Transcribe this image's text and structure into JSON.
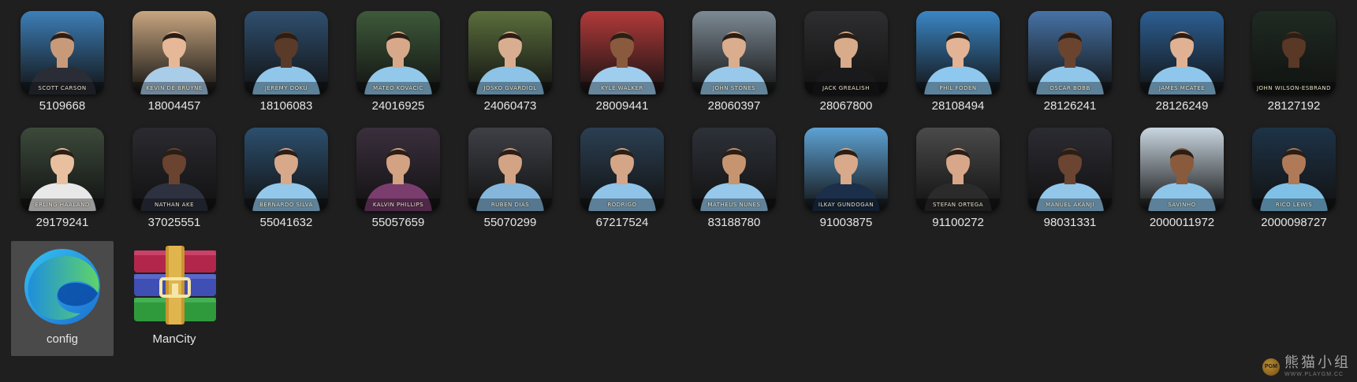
{
  "desktop": {
    "files": [
      {
        "label": "5109668",
        "kind": "photo",
        "caption": "SCOTT CARSON",
        "bg": "#3d7fb8",
        "skin": "#c99a7a",
        "shirt": "#2a2d35"
      },
      {
        "label": "18004457",
        "kind": "photo",
        "caption": "KEVIN DE BRUYNE",
        "bg": "#c8a680",
        "skin": "#e6b898",
        "shirt": "#a9cde8"
      },
      {
        "label": "18106083",
        "kind": "photo",
        "caption": "JEREMY DOKU",
        "bg": "#2f4f6f",
        "skin": "#5a3a28",
        "shirt": "#8fc6ea"
      },
      {
        "label": "24016925",
        "kind": "photo",
        "caption": "MATEO KOVACIC",
        "bg": "#3e5a3a",
        "skin": "#d7a98a",
        "shirt": "#92c8ea"
      },
      {
        "label": "24060473",
        "kind": "photo",
        "caption": "JOSKO GVARDIOL",
        "bg": "#5b6e3c",
        "skin": "#d9ae90",
        "shirt": "#8cc3e6"
      },
      {
        "label": "28009441",
        "kind": "photo",
        "caption": "KYLE WALKER",
        "bg": "#b33a3a",
        "skin": "#8a5a3e",
        "shirt": "#9fcdee"
      },
      {
        "label": "28060397",
        "kind": "photo",
        "caption": "JOHN STONES",
        "bg": "#7d8a94",
        "skin": "#d9ad8e",
        "shirt": "#98c9ea"
      },
      {
        "label": "28067800",
        "kind": "photo",
        "caption": "JACK GREALISH",
        "bg": "#2e2e30",
        "skin": "#d8ab8a",
        "shirt": "#1a1a1c"
      },
      {
        "label": "28108494",
        "kind": "photo",
        "caption": "PHIL FODEN",
        "bg": "#3b86c4",
        "skin": "#e2b394",
        "shirt": "#8ec8ee"
      },
      {
        "label": "28126241",
        "kind": "photo",
        "caption": "OSCAR BOBB",
        "bg": "#4673a6",
        "skin": "#6b4430",
        "shirt": "#90c6ea"
      },
      {
        "label": "28126249",
        "kind": "photo",
        "caption": "JAMES MCATEE",
        "bg": "#2c5f93",
        "skin": "#e0b193",
        "shirt": "#8fc7ec"
      },
      {
        "label": "28127192",
        "kind": "photo",
        "caption": "JOHN WILSON-ESBRAND",
        "bg": "#1f2a22",
        "skin": "#5a3826",
        "shirt": "#141814"
      },
      {
        "label": "29179241",
        "kind": "photo",
        "caption": "ERLING HAALAND",
        "bg": "#3c4a3a",
        "skin": "#e8c0a0",
        "shirt": "#e8e8e8"
      },
      {
        "label": "37025551",
        "kind": "photo",
        "caption": "NATHAN AKE",
        "bg": "#2a2a30",
        "skin": "#6a4430",
        "shirt": "#2d3140"
      },
      {
        "label": "55041632",
        "kind": "photo",
        "caption": "BERNARDO SILVA",
        "bg": "#2c4f6e",
        "skin": "#d7a889",
        "shirt": "#93c8ea"
      },
      {
        "label": "55057659",
        "kind": "photo",
        "caption": "KALVIN PHILLIPS",
        "bg": "#3a2f3d",
        "skin": "#d2a283",
        "shirt": "#7a3d6e"
      },
      {
        "label": "55070299",
        "kind": "photo",
        "caption": "RUBEN DIAS",
        "bg": "#3e4046",
        "skin": "#d3a385",
        "shirt": "#84b7db"
      },
      {
        "label": "67217524",
        "kind": "photo",
        "caption": "RODRIGO",
        "bg": "#2b3f52",
        "skin": "#d4a586",
        "shirt": "#8fc4e8"
      },
      {
        "label": "83188780",
        "kind": "photo",
        "caption": "MATHEUS NUNES",
        "bg": "#2d3138",
        "skin": "#c6956f",
        "shirt": "#95c8ea"
      },
      {
        "label": "91003875",
        "kind": "photo",
        "caption": "ILKAY GUNDOGAN",
        "bg": "#5ea2d4",
        "skin": "#d8a98a",
        "shirt": "#1b2f4a"
      },
      {
        "label": "91100272",
        "kind": "photo",
        "caption": "STEFAN ORTEGA",
        "bg": "#4a4a4a",
        "skin": "#d8a789",
        "shirt": "#2b2b2b"
      },
      {
        "label": "98031331",
        "kind": "photo",
        "caption": "MANUEL AKANJI",
        "bg": "#2b2b32",
        "skin": "#6b4532",
        "shirt": "#92c7ea"
      },
      {
        "label": "2000011972",
        "kind": "photo",
        "caption": "SAVINHO",
        "bg": "#c9d6e0",
        "skin": "#8a5a3c",
        "shirt": "#8ec6ea"
      },
      {
        "label": "2000098727",
        "kind": "photo",
        "caption": "RICO LEWIS",
        "bg": "#1e3347",
        "skin": "#b07a58",
        "shirt": "#7fc0e6"
      },
      {
        "label": "config",
        "kind": "edge",
        "selected": true
      },
      {
        "label": "ManCity",
        "kind": "winrar"
      }
    ],
    "watermark": {
      "logo_text": "PGM",
      "text": "熊猫小组",
      "url": "WWW.PLAYGM.CC"
    }
  }
}
